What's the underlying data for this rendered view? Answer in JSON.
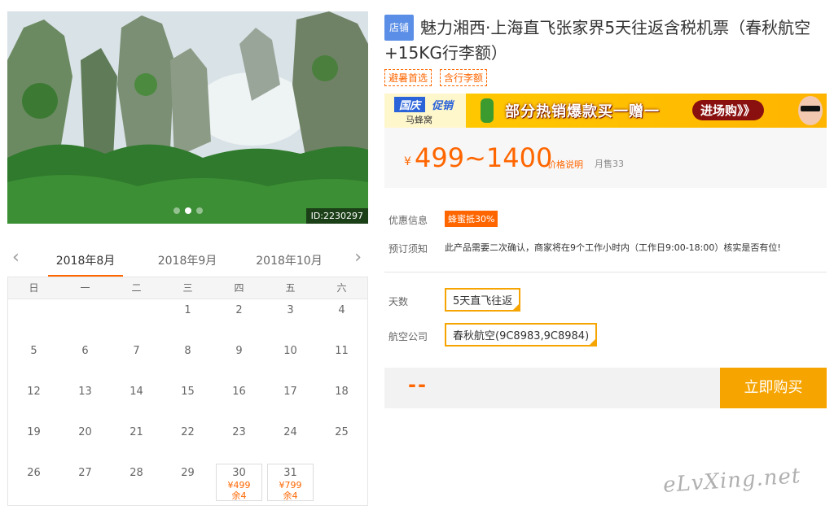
{
  "hero": {
    "id_label": "ID:2230297",
    "slides": 3,
    "active_slide": 1
  },
  "calendar": {
    "months": [
      "2018年8月",
      "2018年9月",
      "2018年10月"
    ],
    "active_month": 0,
    "weekdays": [
      "日",
      "一",
      "二",
      "三",
      "四",
      "五",
      "六"
    ],
    "weeks": [
      [
        {
          "d": ""
        },
        {
          "d": ""
        },
        {
          "d": ""
        },
        {
          "d": "1"
        },
        {
          "d": "2"
        },
        {
          "d": "3"
        },
        {
          "d": "4"
        }
      ],
      [
        {
          "d": "5"
        },
        {
          "d": "6"
        },
        {
          "d": "7"
        },
        {
          "d": "8"
        },
        {
          "d": "9"
        },
        {
          "d": "10"
        },
        {
          "d": "11"
        }
      ],
      [
        {
          "d": "12"
        },
        {
          "d": "13"
        },
        {
          "d": "14"
        },
        {
          "d": "15"
        },
        {
          "d": "16"
        },
        {
          "d": "17"
        },
        {
          "d": "18"
        }
      ],
      [
        {
          "d": "19"
        },
        {
          "d": "20"
        },
        {
          "d": "21"
        },
        {
          "d": "22"
        },
        {
          "d": "23"
        },
        {
          "d": "24"
        },
        {
          "d": "25"
        }
      ],
      [
        {
          "d": "26"
        },
        {
          "d": "27"
        },
        {
          "d": "28"
        },
        {
          "d": "29"
        },
        {
          "d": "30",
          "price": "¥499",
          "stock": "余4"
        },
        {
          "d": "31",
          "price": "¥799",
          "stock": "余4"
        },
        {
          "d": ""
        }
      ]
    ]
  },
  "product": {
    "badge": "店铺",
    "title": "魅力湘西·上海直飞张家界5天往返含税机票（春秋航空+15KG行李额）",
    "tags": [
      "避暑首选",
      "含行李额"
    ]
  },
  "banner": {
    "logo_main": "国庆",
    "logo_accent": "促销",
    "logo_sub": "马蜂窝",
    "text": "部分热销爆款买一赠一",
    "button": "进场购》》"
  },
  "price": {
    "symbol": "¥",
    "range": "499~1400",
    "explain_link": "价格说明",
    "sold": "月售33"
  },
  "info": {
    "discount_label": "优惠信息",
    "discount_value": "蜂蜜抵30%",
    "notice_label": "预订须知",
    "notice_text": "此产品需要二次确认，商家将在9个工作小时内（工作日9:00-18:00）核实是否有位!"
  },
  "options": {
    "days_label": "天数",
    "days_value": "5天直飞往返",
    "airline_label": "航空公司",
    "airline_value": "春秋航空(9C8983,9C8984)"
  },
  "buy": {
    "total": "--",
    "button": "立即购买"
  },
  "watermark": "eLvXing.net",
  "colors": {
    "accent": "#ff6600",
    "button": "#f6a400",
    "badge": "#5b8ee6"
  }
}
